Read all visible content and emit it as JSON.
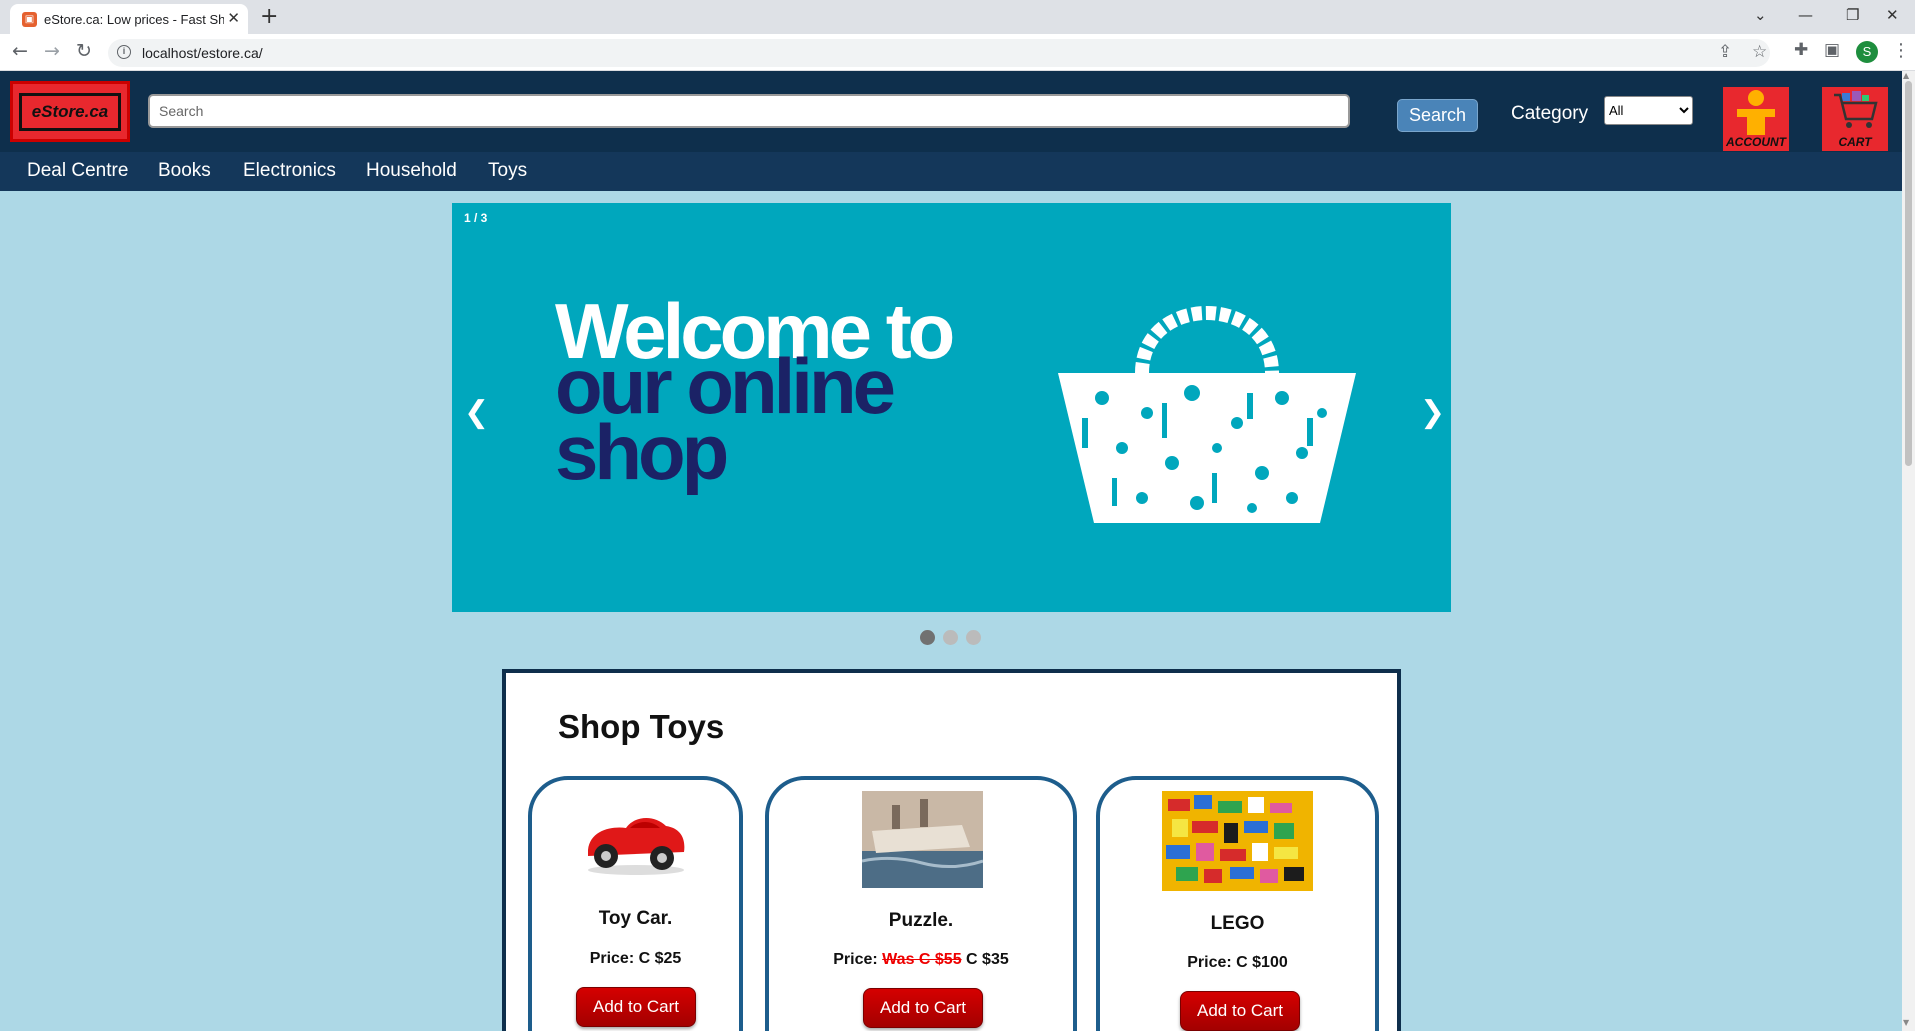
{
  "browser": {
    "tab_title": "eStore.ca: Low prices - Fast Shipp",
    "new_tab": "+",
    "url": "localhost/estore.ca/",
    "profile_initial": "S"
  },
  "header": {
    "logo_text": "eStore.ca",
    "search_placeholder": "Search",
    "search_button": "Search",
    "category_label": "Category",
    "category_selected": "All",
    "account_label": "ACCOUNT",
    "cart_label": "CART"
  },
  "nav": {
    "items": [
      "Deal Centre",
      "Books",
      "Electronics",
      "Household",
      "Toys"
    ]
  },
  "slideshow": {
    "counter": "1 / 3",
    "line1": "Welcome to",
    "line2": "our online",
    "line3": "shop",
    "prev": "❮",
    "next": "❯",
    "active_index": 0,
    "total": 3
  },
  "section": {
    "title": "Shop Toys",
    "products": [
      {
        "name": "Toy Car.",
        "price_prefix": "Price: ",
        "old_price": "",
        "price": "C $25",
        "button": "Add to Cart"
      },
      {
        "name": "Puzzle.",
        "price_prefix": "Price: ",
        "old_price": "Was C $55",
        "price": " C $35",
        "button": "Add to Cart"
      },
      {
        "name": "LEGO",
        "price_prefix": "Price: ",
        "old_price": "",
        "price": "C $100",
        "button": "Add to Cart"
      }
    ]
  },
  "colors": {
    "page_bg": "#add8e6",
    "header_bg": "#0e2f4c",
    "nav_bg": "#14375a",
    "slide_bg": "#00a7bd",
    "accent_red": "#e8282e",
    "card_border": "#1d5d8c"
  }
}
